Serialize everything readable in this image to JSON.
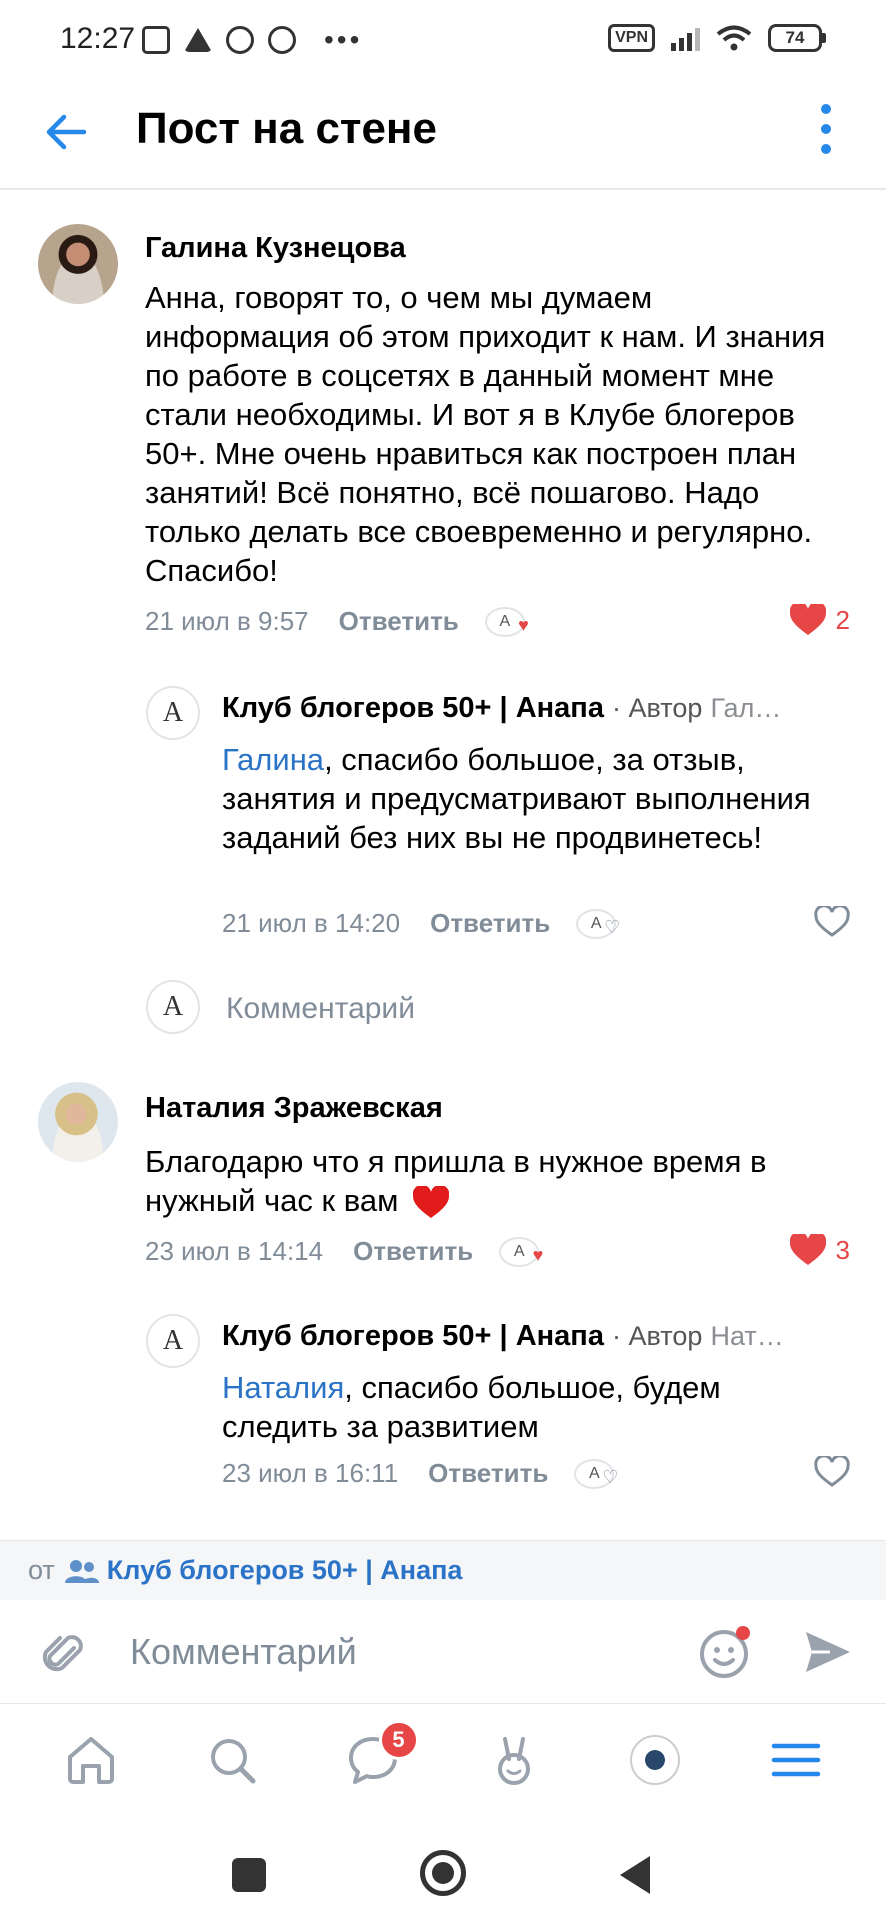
{
  "status_bar": {
    "time": "12:27",
    "vpn": "VPN",
    "battery": "74"
  },
  "header": {
    "title": "Пост на стене"
  },
  "comments": [
    {
      "author": "Галина Кузнецова",
      "text": "Анна, говорят то, о чем мы думаем информация об этом приходит к нам. И знания по работе в соцсетях в данный момент мне стали необходимы. И вот я в Клубе блогеров 50+. Мне очень нравиться как построен план занятий! Всё понятно, всё пошагово. Надо только делать все своевременно и регулярно. Спасибо!",
      "date": "21 июл в 9:57",
      "reply_label": "Ответить",
      "likes": "2",
      "liked": true,
      "reply": {
        "author": "Клуб блогеров 50+ | Анапа",
        "author_suffix": "· Автор",
        "author_tail": "Гал…",
        "mention": "Галина",
        "text": ", спасибо большое, за отзыв, занятия и предусматривают выполнения заданий без них вы не продвинетесь!",
        "date": "21 июл в 14:20",
        "reply_label": "Ответить"
      },
      "reply_input_placeholder": "Комментарий"
    },
    {
      "author": "Наталия Зражевская",
      "text": "Благодарю  что я пришла в нужное время в нужный час к вам",
      "date": "23 июл в 14:14",
      "reply_label": "Ответить",
      "likes": "3",
      "liked": true,
      "reply": {
        "author": "Клуб блогеров 50+ | Анапа",
        "author_suffix": "· Автор",
        "author_tail": "Нат…",
        "mention": "Наталия",
        "text": ", спасибо большое, будем следить за развитием",
        "date": "23 июл в 16:11",
        "reply_label": "Ответить"
      }
    }
  ],
  "from_bar": {
    "from_label": "от",
    "group_name": "Клуб блогеров 50+ | Анапа"
  },
  "composer": {
    "placeholder": "Комментарий"
  },
  "tab_bar": {
    "messages_badge": "5"
  },
  "colors": {
    "accent": "#2688eb",
    "link": "#2a73c6",
    "like_red": "#e64646",
    "secondary_text": "#818c99"
  }
}
